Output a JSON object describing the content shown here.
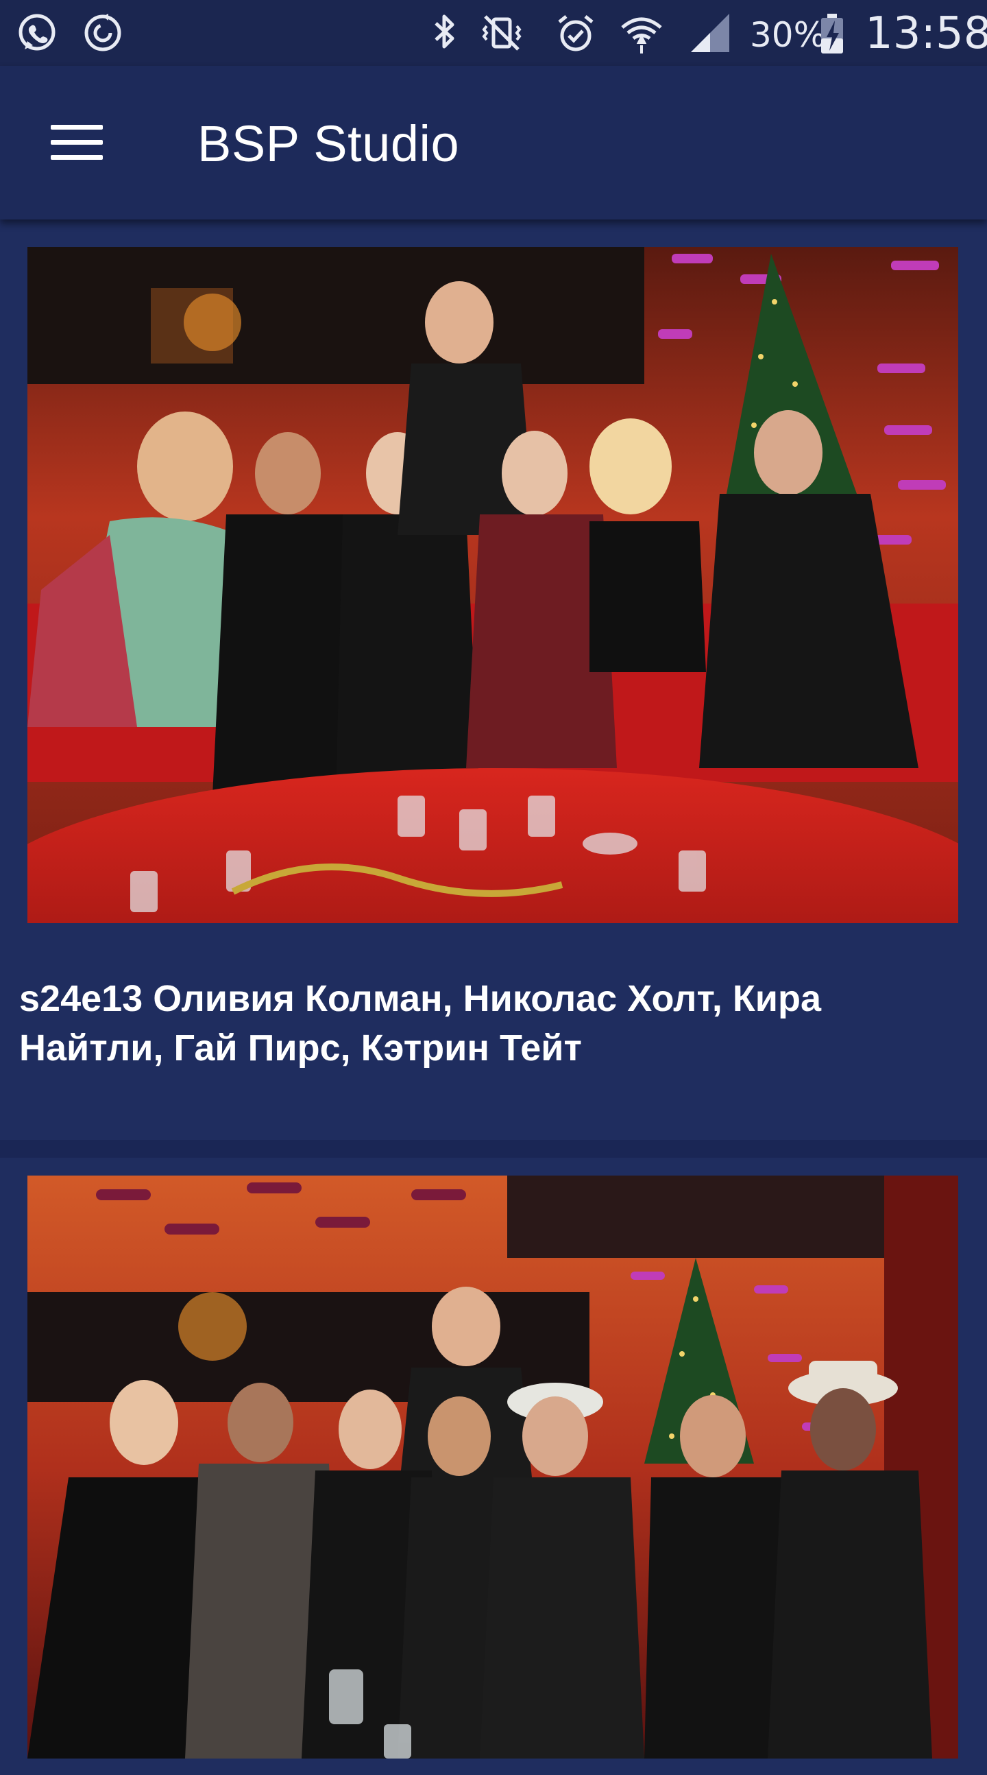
{
  "status_bar": {
    "battery": "30%",
    "time": "13:58",
    "icons": [
      "whatsapp-icon",
      "sync-icon",
      "bluetooth-icon",
      "vibrate-icon",
      "alarm-icon",
      "wifi-icon",
      "signal-icon",
      "battery-charging-icon"
    ]
  },
  "app_bar": {
    "menu_icon": "hamburger-menu-icon",
    "title": "BSP Studio"
  },
  "episodes": [
    {
      "title": "s24e13 Оливия Колман, Николас Холт, Кира Найтли, Гай Пирс, Кэтрин Тейт",
      "thumbnail": "episode-photo"
    },
    {
      "title": "",
      "thumbnail": "episode-photo"
    }
  ]
}
